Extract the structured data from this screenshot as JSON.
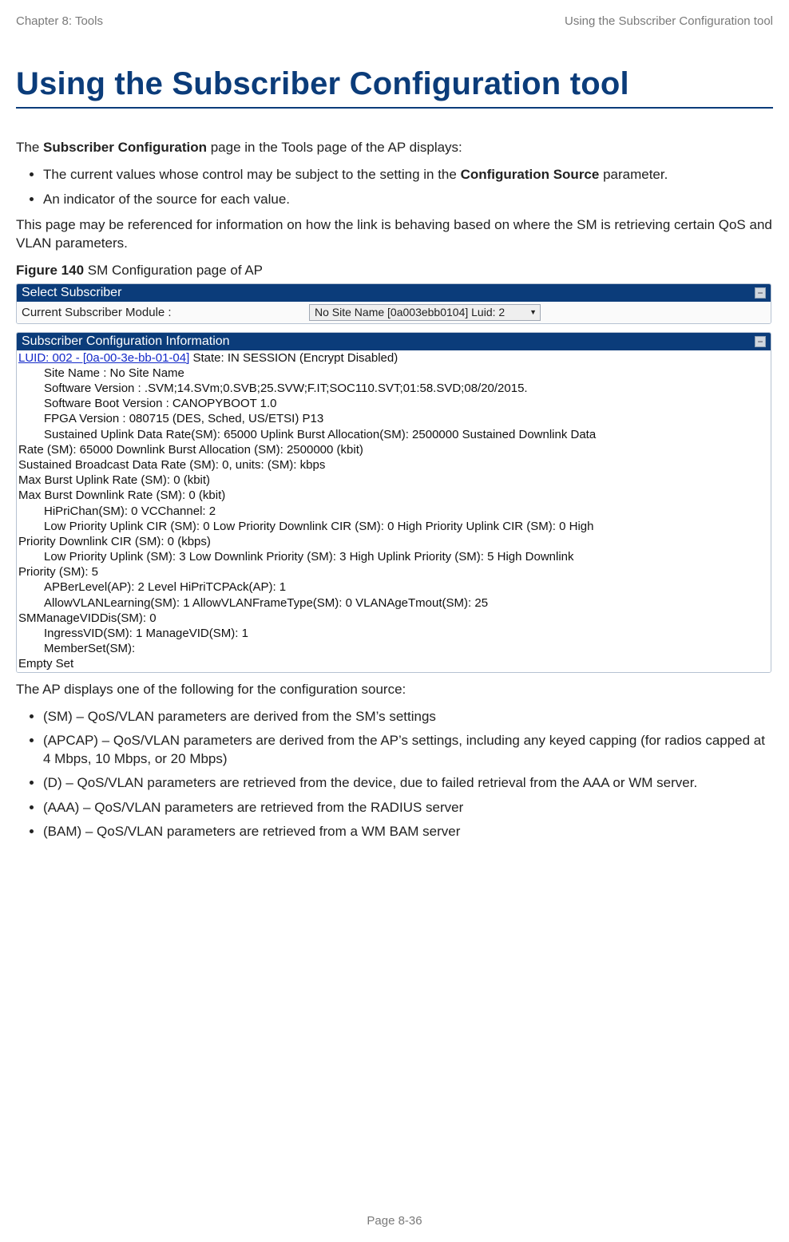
{
  "header": {
    "left": "Chapter 8:  Tools",
    "right": "Using the Subscriber Configuration tool"
  },
  "title": "Using the Subscriber Configuration tool",
  "intro": {
    "lead_before": "The ",
    "lead_bold": "Subscriber Configuration",
    "lead_after": " page in the Tools page of the AP displays:",
    "bullets": [
      {
        "pre": "The current values whose control may be subject to the setting in the ",
        "bold": "Configuration Source",
        "post": " parameter."
      },
      {
        "pre": "An indicator of the source for each value.",
        "bold": "",
        "post": ""
      }
    ],
    "para2": "This page may be referenced for information on how the link is behaving based on where the SM is retrieving certain QoS and VLAN parameters."
  },
  "figure": {
    "label_bold": "Figure 140",
    "label_rest": " SM Configuration page of AP"
  },
  "panel1": {
    "title": "Select Subscriber",
    "row_label": "Current Subscriber Module :",
    "dropdown_selected": "No Site Name [0a003ebb0104] Luid: 2"
  },
  "panel2": {
    "title": "Subscriber Configuration Information",
    "luid_link": "LUID: 002 - [0a-00-3e-bb-01-04]",
    "state_text": " State: IN SESSION (Encrypt Disabled)",
    "lines_a": [
      "Site Name : No Site Name",
      "Software Version : .SVM;14.SVm;0.SVB;25.SVW;F.IT;SOC110.SVT;01:58.SVD;08/20/2015.",
      "Software Boot Version : CANOPYBOOT 1.0",
      "FPGA Version : 080715 (DES, Sched, US/ETSI) P13"
    ],
    "wrap1_indent": "Sustained Uplink Data Rate(SM): 65000 Uplink Burst Allocation(SM): 2500000 Sustained Downlink Data",
    "wrap1_flush": "Rate (SM): 65000 Downlink Burst Allocation (SM): 2500000 (kbit)",
    "lines_b": [
      "Sustained Broadcast Data Rate (SM): 0, units: (SM): kbps",
      "Max Burst Uplink Rate (SM): 0 (kbit)",
      "Max Burst Downlink Rate (SM): 0 (kbit)"
    ],
    "lines_c": [
      "HiPriChan(SM): 0 VCChannel: 2"
    ],
    "wrap2_indent": "Low Priority Uplink CIR (SM): 0 Low Priority Downlink CIR (SM): 0 High Priority Uplink CIR (SM): 0 High",
    "wrap2_flush": "Priority Downlink CIR (SM): 0 (kbps)",
    "wrap3_indent": "Low Priority Uplink (SM): 3 Low Downlink Priority (SM): 3 High Uplink Priority (SM): 5 High Downlink",
    "wrap3_flush": "Priority (SM): 5",
    "lines_d": [
      "APBerLevel(AP): 2 Level HiPriTCPAck(AP): 1",
      "AllowVLANLearning(SM): 1 AllowVLANFrameType(SM): 0 VLANAgeTmout(SM): 25"
    ],
    "flush_e": "SMManageVIDDis(SM): 0",
    "lines_f": [
      "IngressVID(SM): 1 ManageVID(SM): 1",
      "MemberSet(SM):"
    ],
    "flush_g": "Empty Set"
  },
  "after": {
    "lead": "The AP displays one of the following for the configuration source:",
    "bullets": [
      "(SM) – QoS/VLAN parameters are derived from the SM’s settings",
      "(APCAP) – QoS/VLAN parameters are derived from the AP’s settings, including any keyed capping (for radios capped at 4 Mbps, 10 Mbps, or 20 Mbps)",
      "(D) – QoS/VLAN parameters are retrieved from the device, due to failed retrieval from the AAA or WM server.",
      "(AAA) – QoS/VLAN parameters are retrieved from the RADIUS server",
      "(BAM) – QoS/VLAN parameters are retrieved from a WM BAM server"
    ]
  },
  "footer": "Page 8-36"
}
